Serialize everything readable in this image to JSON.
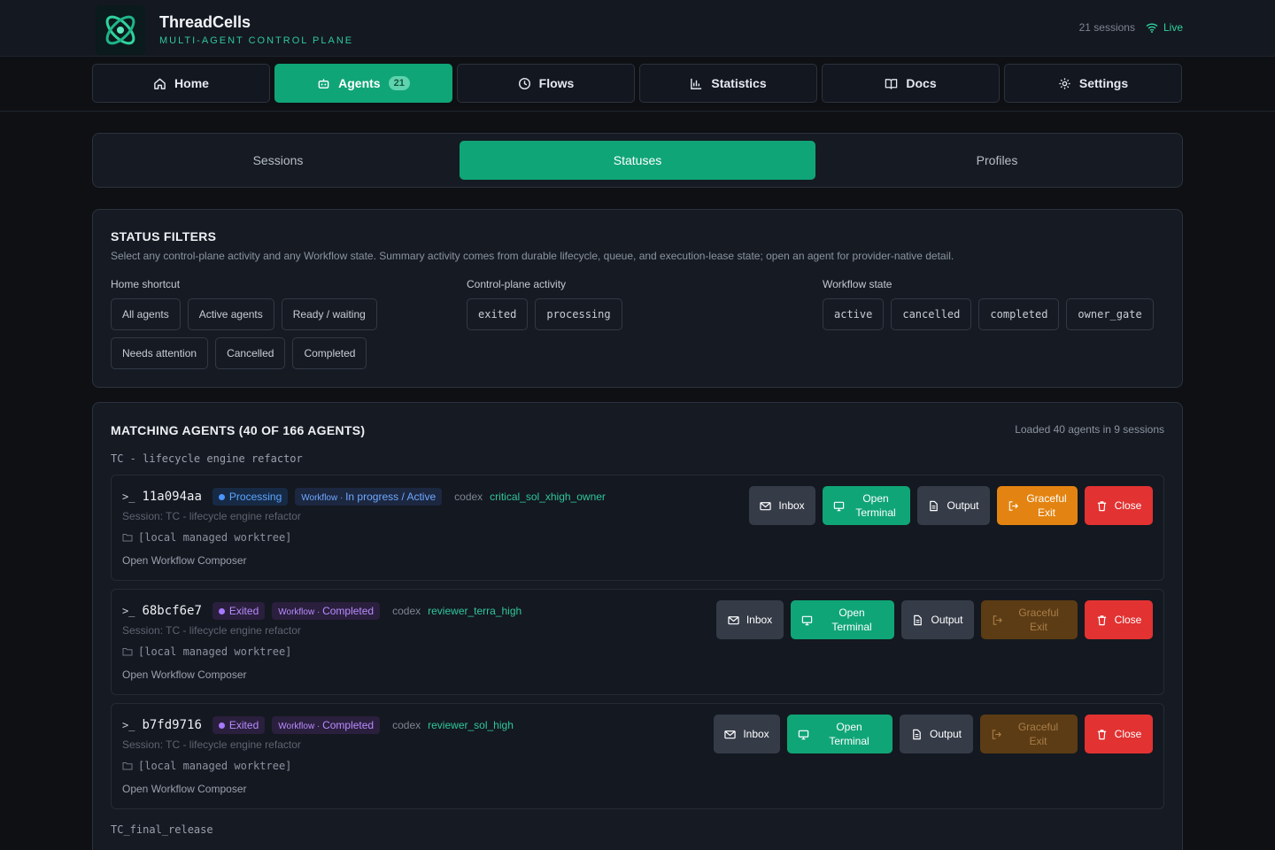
{
  "header": {
    "title": "ThreadCells",
    "subtitle": "MULTI-AGENT CONTROL PLANE",
    "sessions": "21 sessions",
    "live": "Live"
  },
  "nav": {
    "tabs": [
      {
        "label": "Home",
        "icon": "home-icon"
      },
      {
        "label": "Agents",
        "icon": "robot-icon",
        "badge": "21",
        "active": true
      },
      {
        "label": "Flows",
        "icon": "clock-icon"
      },
      {
        "label": "Statistics",
        "icon": "bar-chart-icon"
      },
      {
        "label": "Docs",
        "icon": "book-icon"
      },
      {
        "label": "Settings",
        "icon": "gear-icon"
      }
    ]
  },
  "subtabs": [
    "Sessions",
    "Statuses",
    "Profiles"
  ],
  "filters": {
    "title": "STATUS FILTERS",
    "description": "Select any control-plane activity and any Workflow state. Summary activity comes from durable lifecycle, queue, and execution-lease state; open an agent for provider-native detail.",
    "home_label": "Home shortcut",
    "home_chips": [
      "All agents",
      "Active agents",
      "Ready / waiting",
      "Needs attention",
      "Cancelled",
      "Completed"
    ],
    "activity_label": "Control-plane activity",
    "activity_chips": [
      "exited",
      "processing"
    ],
    "workflow_label": "Workflow state",
    "workflow_chips": [
      "active",
      "cancelled",
      "completed",
      "owner_gate"
    ]
  },
  "matching": {
    "title": "MATCHING AGENTS (40 OF 166 AGENTS)",
    "loaded": "Loaded 40 agents in 9 sessions",
    "group1": "TC - lifecycle engine refactor",
    "group2": "TC_final_release",
    "agents": [
      {
        "prompt": ">_",
        "id": "11a094aa",
        "status": "Processing",
        "workflow_prefix": "Workflow · ",
        "workflow": "In progress / Active",
        "provider": "codex",
        "profile": "critical_sol_xhigh_owner",
        "session": "Session: TC - lifecycle engine refactor",
        "worktree": "[local managed worktree]",
        "compose": "Open Workflow Composer",
        "buttons": {
          "inbox": "Inbox",
          "terminal": "Open Terminal",
          "output": "Output",
          "graceful": "Graceful Exit",
          "close": "Close"
        }
      },
      {
        "prompt": ">_",
        "id": "68bcf6e7",
        "status": "Exited",
        "workflow_prefix": "Workflow · ",
        "workflow": "Completed",
        "provider": "codex",
        "profile": "reviewer_terra_high",
        "session": "Session: TC - lifecycle engine refactor",
        "worktree": "[local managed worktree]",
        "compose": "Open Workflow Composer",
        "buttons": {
          "inbox": "Inbox",
          "terminal": "Open Terminal",
          "output": "Output",
          "graceful": "Graceful Exit",
          "close": "Close"
        }
      },
      {
        "prompt": ">_",
        "id": "b7fd9716",
        "status": "Exited",
        "workflow_prefix": "Workflow · ",
        "workflow": "Completed",
        "provider": "codex",
        "profile": "reviewer_sol_high",
        "session": "Session: TC - lifecycle engine refactor",
        "worktree": "[local managed worktree]",
        "compose": "Open Workflow Composer",
        "buttons": {
          "inbox": "Inbox",
          "terminal": "Open Terminal",
          "output": "Output",
          "graceful": "Graceful Exit",
          "close": "Close"
        }
      }
    ]
  },
  "colors": {
    "accent": "#10a577",
    "processing": "#4b95ff",
    "exited": "#a779ff",
    "graceful": "#e38412",
    "close": "#e23232"
  }
}
